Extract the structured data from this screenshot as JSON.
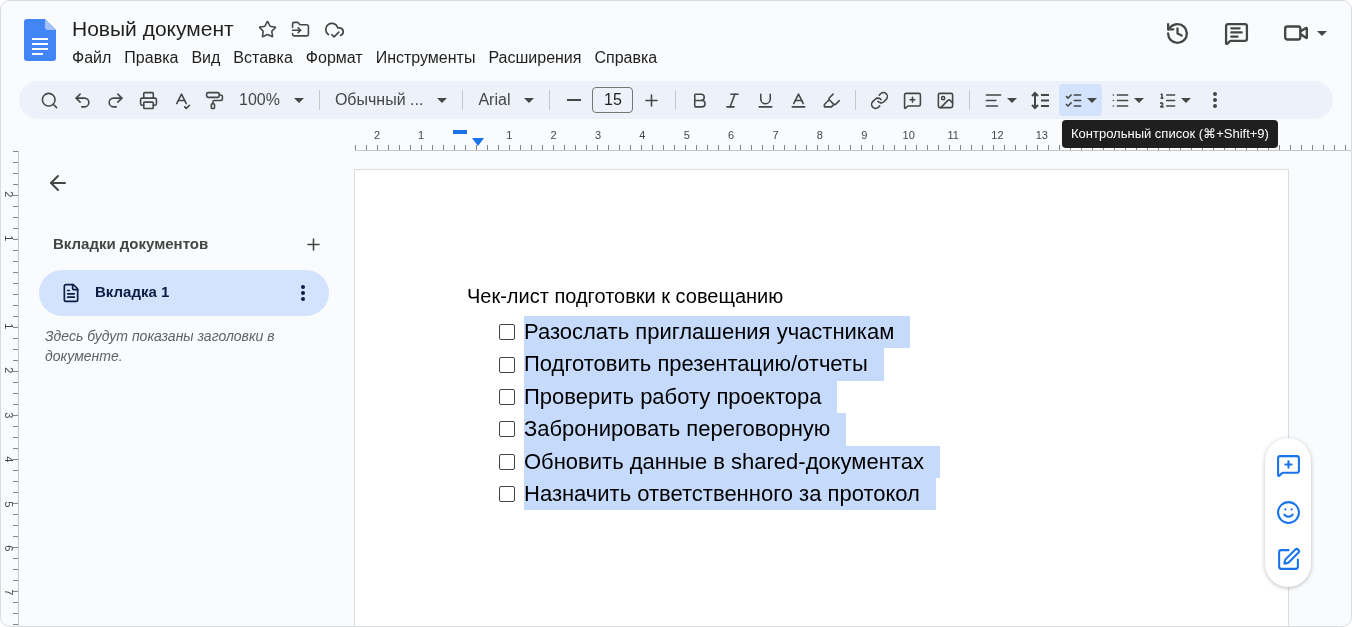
{
  "document": {
    "title": "Новый документ"
  },
  "menu": [
    {
      "label": "Файл"
    },
    {
      "label": "Правка"
    },
    {
      "label": "Вид"
    },
    {
      "label": "Вставка"
    },
    {
      "label": "Формат"
    },
    {
      "label": "Инструменты"
    },
    {
      "label": "Расширения"
    },
    {
      "label": "Справка"
    }
  ],
  "toolbar": [
    [
      {
        "kind": "button"
      },
      {
        "kind": "button"
      },
      {
        "kind": "button"
      },
      {
        "kind": "button"
      },
      {
        "kind": "button"
      },
      {
        "kind": "button"
      },
      {
        "kind": "dropdown",
        "label": "100%"
      }
    ],
    [
      {
        "kind": "dropdown",
        "label": "Обычный ..."
      }
    ],
    [
      {
        "kind": "dropdown",
        "label": "Arial"
      }
    ],
    [
      {
        "kind": "button"
      },
      {
        "kind": "field",
        "value": "15"
      },
      {
        "kind": "button"
      }
    ],
    [
      {
        "kind": "button"
      },
      {
        "kind": "button"
      },
      {
        "kind": "button"
      },
      {
        "kind": "button"
      },
      {
        "kind": "button"
      }
    ],
    [
      {
        "kind": "button"
      },
      {
        "kind": "button"
      },
      {
        "kind": "button"
      }
    ],
    [
      {
        "kind": "split",
        "selected": false
      },
      {
        "kind": "button"
      },
      {
        "kind": "split",
        "selected": true
      },
      {
        "kind": "split",
        "selected": false
      },
      {
        "kind": "split",
        "selected": false
      },
      {
        "kind": "button"
      }
    ]
  ],
  "tooltip": "Контрольный список (⌘+Shift+9)",
  "ruler": {
    "before": [
      "2",
      "1"
    ],
    "after": [
      "1",
      "2",
      "3",
      "4",
      "5",
      "6",
      "7",
      "8",
      "9",
      "10",
      "11",
      "12",
      "13"
    ]
  },
  "vertical_ruler": {
    "before": [
      "2",
      "1"
    ],
    "after": [
      "1",
      "2",
      "3",
      "4",
      "5",
      "6",
      "7"
    ]
  },
  "sidebar": {
    "heading": "Вкладки документов",
    "tabs": [
      {
        "label": "Вкладка 1",
        "selected": true
      }
    ],
    "hint": "Здесь будут показаны заголовки в документе."
  },
  "page": {
    "heading": "Чек-лист подготовки к совещанию",
    "items": [
      {
        "text": "Разослать приглашения участникам",
        "checked": false,
        "selected": true
      },
      {
        "text": "Подготовить презентацию/отчеты",
        "checked": false,
        "selected": true
      },
      {
        "text": "Проверить работу проектора",
        "checked": false,
        "selected": true
      },
      {
        "text": "Забронировать переговорную",
        "checked": false,
        "selected": true
      },
      {
        "text": "Обновить данные в shared-документах",
        "checked": false,
        "selected": true
      },
      {
        "text": "Назначить ответственного за протокол",
        "checked": false,
        "selected": true
      }
    ]
  }
}
